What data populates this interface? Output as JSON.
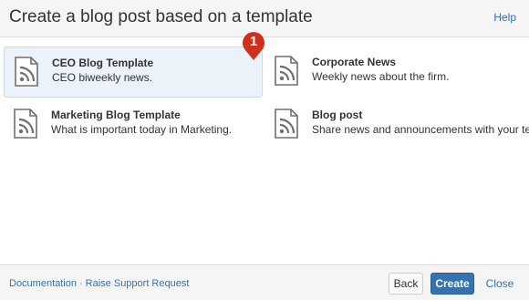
{
  "dialog": {
    "title": "Create a blog post based on a template",
    "help_label": "Help"
  },
  "templates": [
    {
      "name": "CEO Blog Template",
      "description": "CEO biweekly news.",
      "icon": "rss-page-icon",
      "selected": true
    },
    {
      "name": "Corporate News",
      "description": "Weekly news about the firm.",
      "icon": "rss-page-icon",
      "selected": false
    },
    {
      "name": "Marketing Blog Template",
      "description": "What is important today in Marketing.",
      "icon": "rss-page-icon",
      "selected": false
    },
    {
      "name": "Blog post",
      "description": "Share news and announcements with your team.",
      "icon": "rss-page-icon",
      "selected": false
    }
  ],
  "callout": {
    "number": "1",
    "color": "#d0301b"
  },
  "footer": {
    "documentation_label": "Documentation",
    "separator": "·",
    "support_label": "Raise Support Request",
    "back_label": "Back",
    "create_label": "Create",
    "close_label": "Close"
  },
  "colors": {
    "accent": "#3572b0",
    "selected_bg": "#ebf2f9"
  }
}
